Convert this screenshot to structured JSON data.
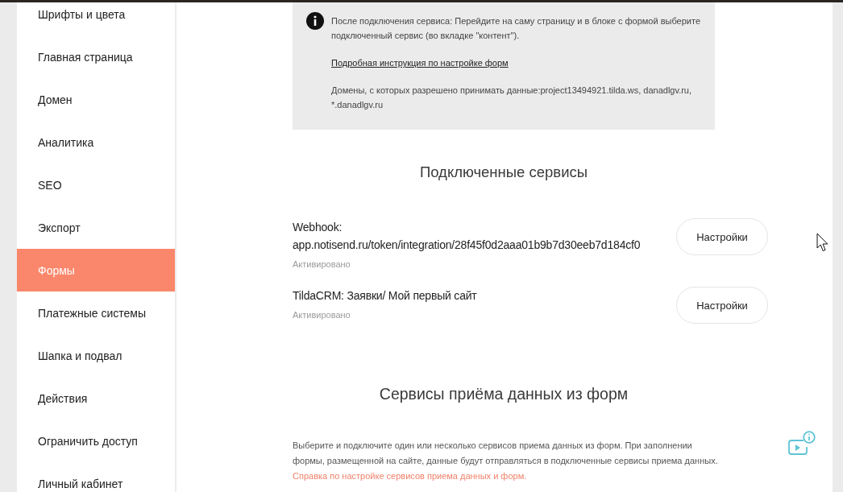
{
  "sidebar": {
    "items": [
      {
        "label": "Шрифты и цвета",
        "selected": false
      },
      {
        "label": "Главная страница",
        "selected": false
      },
      {
        "label": "Домен",
        "selected": false
      },
      {
        "label": "Аналитика",
        "selected": false
      },
      {
        "label": "SEO",
        "selected": false
      },
      {
        "label": "Экспорт",
        "selected": false
      },
      {
        "label": "Формы",
        "selected": true
      },
      {
        "label": "Платежные системы",
        "selected": false
      },
      {
        "label": "Шапка и подвал",
        "selected": false
      },
      {
        "label": "Действия",
        "selected": false
      },
      {
        "label": "Ограничить доступ",
        "selected": false
      },
      {
        "label": "Личный кабинет",
        "selected": false
      }
    ]
  },
  "info_box": {
    "text": "После подключения сервиса: Перейдите на саму страницу и в блоке с формой выберите подключенный сервис (во вкладке \"контент\").",
    "link": "Подробная инструкция по настройке форм",
    "domains": "Домены, с которых разрешено принимать данные:project13494921.tilda.ws, danadlgv.ru, *.danadlgv.ru"
  },
  "connected_services": {
    "title": "Подключенные сервисы",
    "items": [
      {
        "name": "Webhook: app.notisend.ru/token/integration/28f45f0d2aaa01b9b7d30eeb7d184cf0",
        "status": "Активировано",
        "button": "Настройки"
      },
      {
        "name": "TildaCRM: Заявки/ Мой первый сайт",
        "status": "Активировано",
        "button": "Настройки"
      }
    ]
  },
  "form_services": {
    "title": "Сервисы приёма данных из форм",
    "description": "Выберите и подключите один или несколько сервисов приема данных из форм. При заполнении формы, размещенной на сайте, данные будут отправляться в подключенные сервисы приема данных.",
    "help_link": "Справка по настройке сервисов приема данных и форм."
  }
}
